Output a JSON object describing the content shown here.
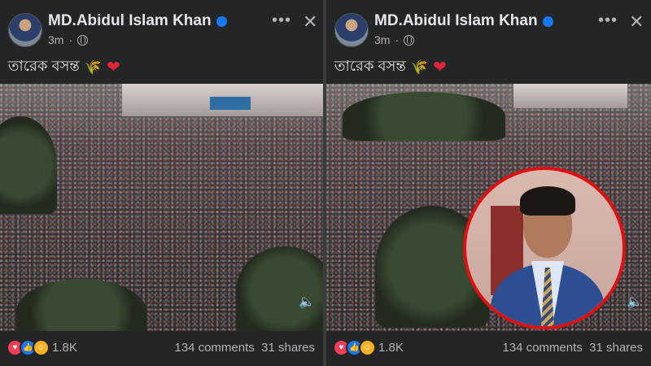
{
  "posts": [
    {
      "author": "MD.Abidul Islam Khan",
      "time": "3m",
      "caption": "তারেক বসন্ত",
      "reaction_count": "1.8K",
      "comments": "134 comments",
      "shares": "31 shares"
    },
    {
      "author": "MD.Abidul Islam Khan",
      "time": "3m",
      "caption": "তারেক বসন্ত",
      "reaction_count": "1.8K",
      "comments": "134 comments",
      "shares": "31 shares"
    }
  ],
  "icons": {
    "more": "more-options-icon",
    "close": "close-icon",
    "privacy": "globe-icon",
    "verified": "verified-badge-icon",
    "volume": "volume-icon"
  },
  "colors": {
    "background": "#242526",
    "text": "#e4e6eb",
    "muted": "#b0b3b8",
    "verified": "#1877f2",
    "inset_border": "#e01010"
  }
}
